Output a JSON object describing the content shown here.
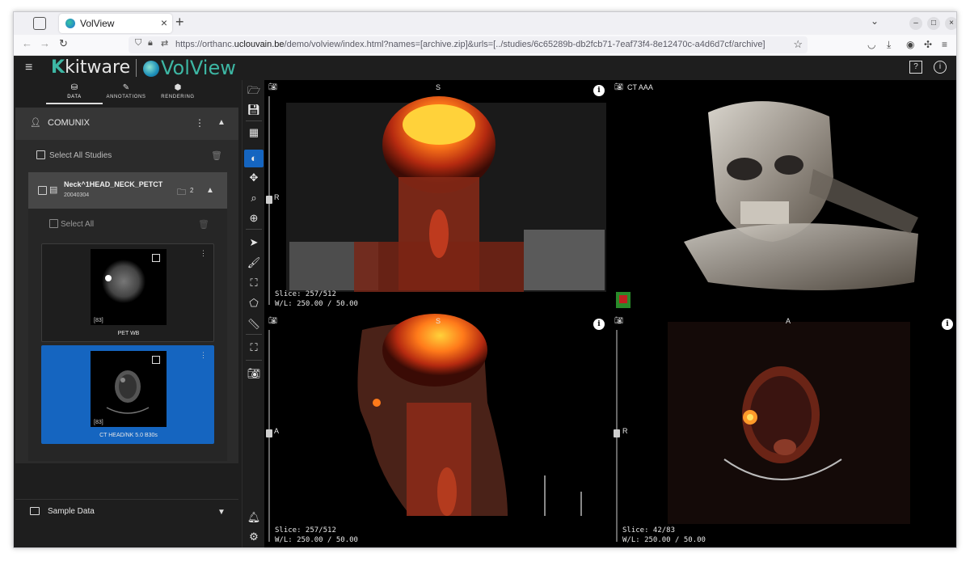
{
  "browser": {
    "tab_title": "VolView",
    "url_prefix": "https://orthanc.",
    "url_domain": "uclouvain.be",
    "url_rest": "/demo/volview/index.html?names=[archive.zip]&urls=[../studies/6c65289b-db2fcb71-7eaf73f4-8e12470c-a4d6d7cf/archive]"
  },
  "app": {
    "logo_kitware": "kitware",
    "logo_volview": "VolView"
  },
  "left_tabs": [
    {
      "label": "DATA",
      "icon": "database-icon"
    },
    {
      "label": "ANNOTATIONS",
      "icon": "pencil-icon"
    },
    {
      "label": "RENDERING",
      "icon": "cube-icon"
    }
  ],
  "patient": {
    "name": "COMUNIX"
  },
  "studies": {
    "select_all_label": "Select All Studies",
    "study_name": "Neck^1HEAD_NECK_PETCT",
    "study_date": "20040304",
    "series_count": "2",
    "select_all_series_label": "Select All",
    "series": [
      {
        "name": "PET WB",
        "count": "[83]"
      },
      {
        "name": "CT HEAD/NK 5.0 B30s",
        "count": "[83]"
      }
    ]
  },
  "sample_data": {
    "label": "Sample Data"
  },
  "viewports": {
    "coronal": {
      "top_label": "S",
      "left_label": "R",
      "slice": "Slice: 257/512",
      "wl": "W/L: 250.00 / 50.00"
    },
    "volume": {
      "title": "CT AAA"
    },
    "sagittal": {
      "top_label": "S",
      "left_label": "A",
      "slice": "Slice: 257/512",
      "wl": "W/L: 250.00 / 50.00"
    },
    "axial": {
      "top_label": "A",
      "left_label": "R",
      "slice": "Slice: 42/83",
      "wl": "W/L: 250.00 / 50.00"
    }
  },
  "colors": {
    "accent": "#1565c0",
    "teal": "#3db7a4",
    "panel": "#1e1e1e"
  }
}
